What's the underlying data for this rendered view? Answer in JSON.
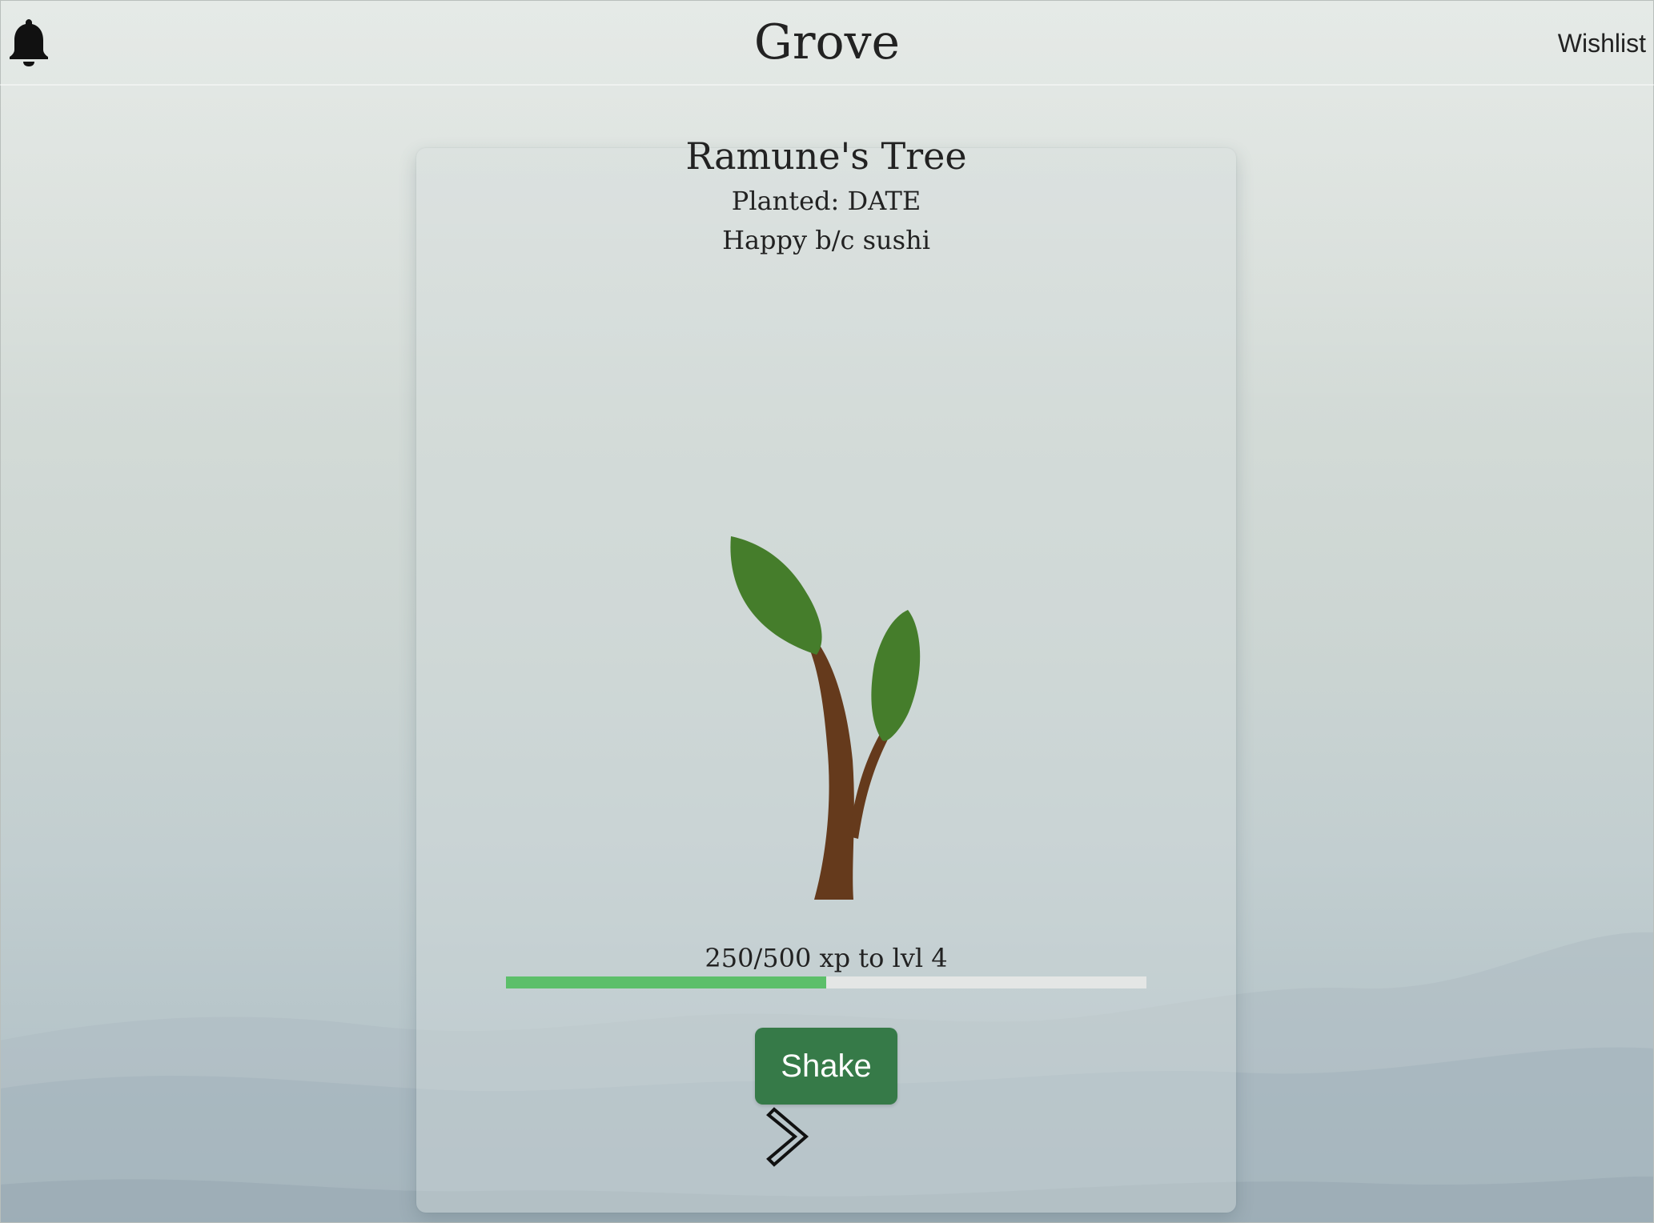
{
  "header": {
    "brand": "Grove",
    "wishlist_label": "Wishlist",
    "notification_icon": "bell-icon"
  },
  "tree": {
    "title": "Ramune's Tree",
    "planted": "Planted: DATE",
    "mood": "Happy b/c sushi",
    "illustration": "sapling-illustration"
  },
  "progress": {
    "label": "250/500 xp to lvl 4",
    "fraction": 0.5
  },
  "actions": {
    "shake_label": "Shake",
    "next_icon": "chevron-right-icon"
  },
  "colors": {
    "progress_fill": "#5cbf6a",
    "progress_track": "#e4e6e5",
    "button": "#367a48",
    "leaf": "#457d2b",
    "trunk": "#653a1c"
  }
}
